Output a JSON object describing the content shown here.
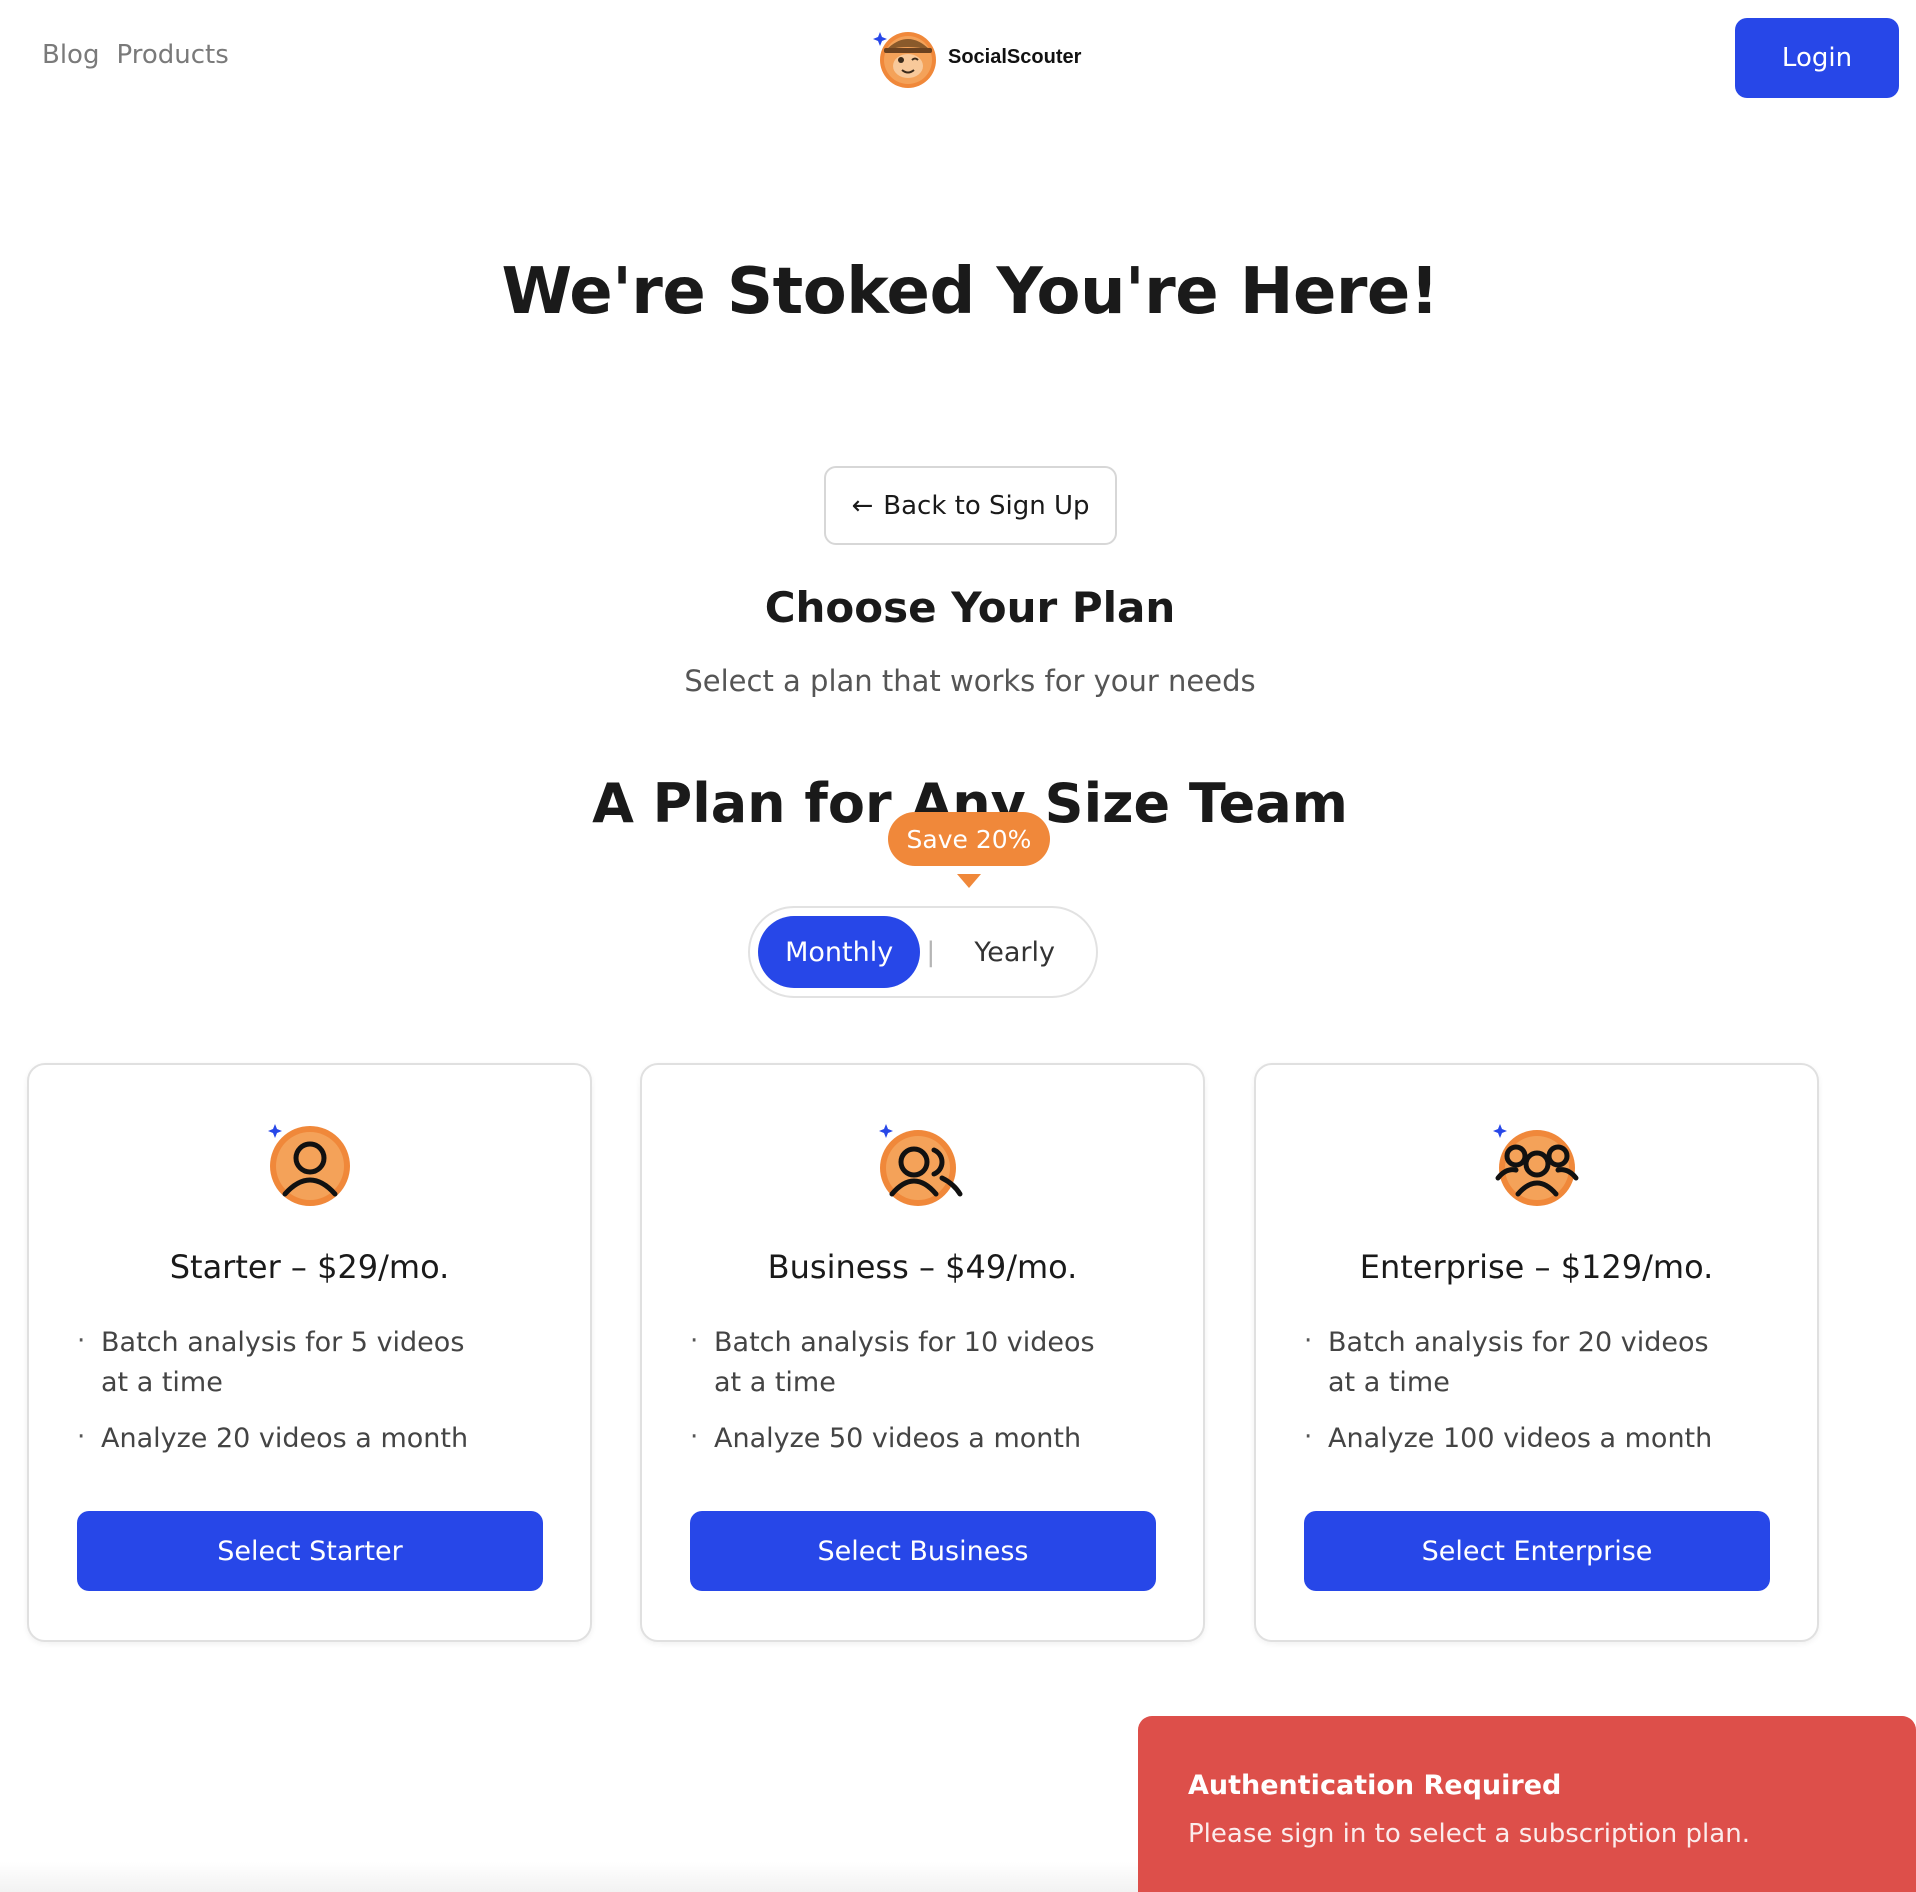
{
  "nav": {
    "links": [
      "Blog",
      "Products"
    ],
    "brand_name": "SocialScouter",
    "login_label": "Login"
  },
  "hero": {
    "title": "We're Stoked You're Here!"
  },
  "back_button": {
    "label": "Back to Sign Up",
    "icon": "arrow-left-icon"
  },
  "plan_section": {
    "title": "Choose Your Plan",
    "subtitle": "Select a plan that works for your needs",
    "heading": "A Plan for Any Size Team",
    "save_badge": "Save 20%",
    "billing_toggle": {
      "monthly": "Monthly",
      "separator": "|",
      "yearly": "Yearly",
      "selected": "Monthly"
    }
  },
  "plans": [
    {
      "name": "Starter – $29/mo.",
      "features": [
        "Batch analysis for 5 videos at a time",
        "Analyze 20 videos a month"
      ],
      "button": "Select Starter",
      "icon": "single-user-icon"
    },
    {
      "name": "Business – $49/mo.",
      "features": [
        "Batch analysis for 10 videos at a time",
        "Analyze 50 videos a month"
      ],
      "button": "Select Business",
      "icon": "two-users-icon"
    },
    {
      "name": "Enterprise – $129/mo.",
      "features": [
        "Batch analysis for 20 videos at a time",
        "Analyze 100 videos a month"
      ],
      "button": "Select Enterprise",
      "icon": "group-users-icon"
    }
  ],
  "toast": {
    "title": "Authentication Required",
    "message": "Please sign in to select a subscription plan."
  },
  "colors": {
    "primary": "#2747e8",
    "accent_orange": "#f0883a",
    "toast_red": "#dd4f4a",
    "border": "#e0e0e0"
  }
}
